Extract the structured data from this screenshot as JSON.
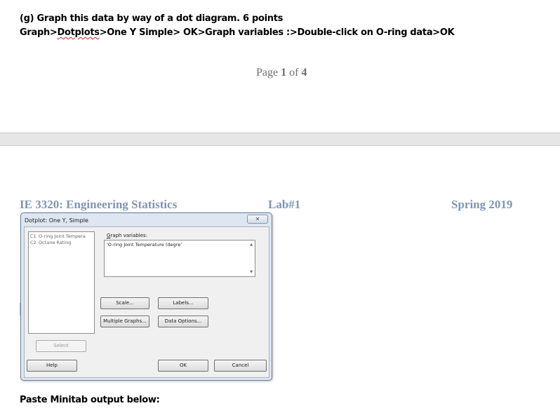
{
  "document": {
    "instruction_title": "(g)  Graph this data by way of a dot diagram. 6 points",
    "instruction_steps_prefix": "Graph>",
    "instruction_steps_flagged": "Dotplots",
    "instruction_steps_suffix": ">One Y Simple> OK>Graph variables :>Double-click on O-ring data>OK",
    "page_number_label": "Page",
    "page_number_current": "1",
    "page_number_of": "of",
    "page_number_total": "4",
    "header_course": "IE 3320: Engineering Statistics",
    "header_lab": "Lab#1",
    "header_term": "Spring 2019",
    "paste_prompt": "Paste Minitab output below:"
  },
  "dialog": {
    "title": "Dotplot: One Y, Simple",
    "close_glyph": "✕",
    "variables": [
      {
        "col": "C1",
        "name": "O-ring Joint Tempera"
      },
      {
        "col": "C2",
        "name": "Octane Rating"
      }
    ],
    "graph_variables_label": "Graph variables:",
    "graph_variables_value": "'O-ring Joint Temperature (degre'",
    "scroll_up_glyph": "▲",
    "scroll_down_glyph": "▼",
    "buttons": {
      "scale": "Scale...",
      "labels": "Labels...",
      "multiple_graphs": "Multiple Graphs...",
      "data_options": "Data Options...",
      "select": "Select",
      "help": "Help",
      "ok": "OK",
      "cancel": "Cancel"
    }
  }
}
